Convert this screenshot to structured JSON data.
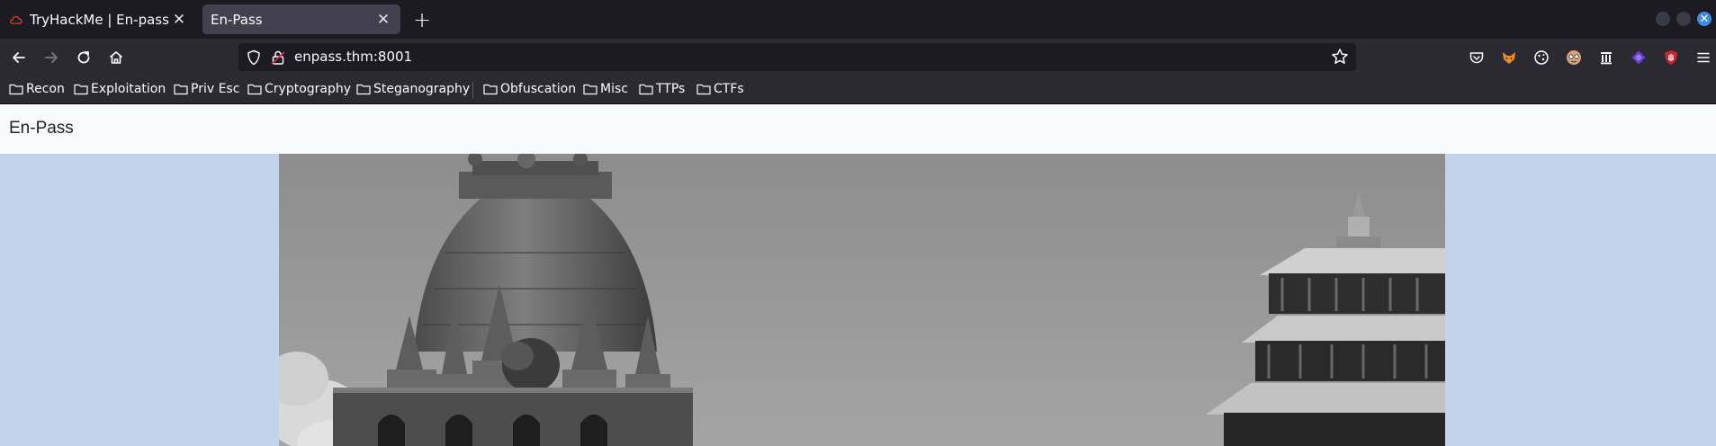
{
  "tabs": [
    {
      "title": "TryHackMe | En-pass",
      "active": false
    },
    {
      "title": "En-Pass",
      "active": true
    }
  ],
  "window": {
    "close_glyph": "✕"
  },
  "nav": {
    "url": "enpass.thm:8001",
    "icons": [
      "back-arrow-icon",
      "forward-arrow-icon",
      "reload-icon",
      "home-icon"
    ]
  },
  "extensions": [
    "pocket-icon",
    "foxyproxy-icon",
    "cookie-icon",
    "user-agent-icon",
    "wayback-icon",
    "dark-ext-icon",
    "ublock-icon",
    "menu-icon"
  ],
  "bookmarks": [
    {
      "label": "Recon"
    },
    {
      "label": "Exploitation"
    },
    {
      "label": "Priv Esc"
    },
    {
      "label": "Cryptography"
    },
    {
      "label": "Steganography"
    },
    {
      "label": "Obfuscation"
    },
    {
      "label": "Misc"
    },
    {
      "label": "TTPs"
    },
    {
      "label": "CTFs"
    }
  ],
  "page": {
    "brand": "En-Pass",
    "background_color": "#c3d3ea"
  },
  "colors": {
    "chrome_dark": "#1c1b22",
    "toolbar": "#2b2a33",
    "active_tab": "#42414d",
    "accent_close": "#3f8be4"
  }
}
